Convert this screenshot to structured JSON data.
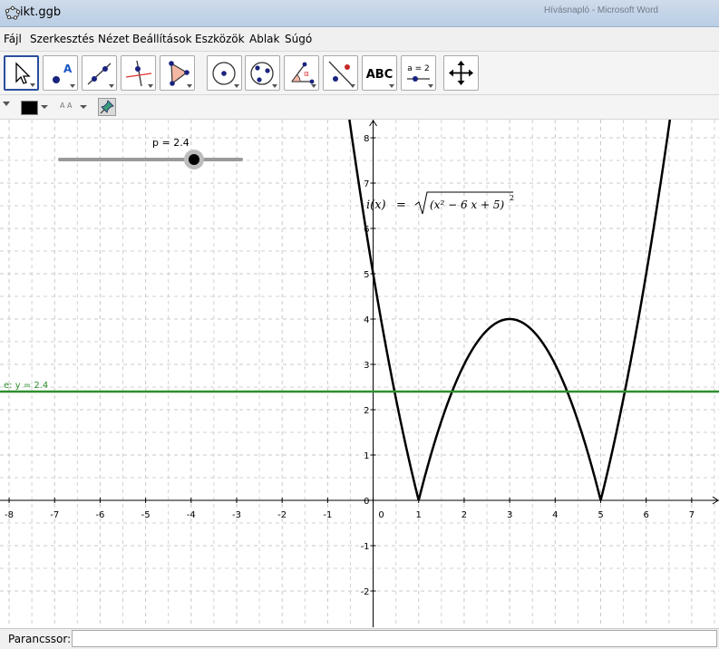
{
  "window": {
    "title": "ikt.ggb",
    "background_text": "Hívásnapló - Microsoft Word"
  },
  "menu": [
    "Fájl",
    "Szerkesztés",
    "Nézet",
    "Beállítások",
    "Eszközök",
    "Ablak",
    "Súgó"
  ],
  "toolbar": {
    "tools": [
      {
        "name": "move-tool-icon"
      },
      {
        "name": "new-point-tool-icon"
      },
      {
        "name": "line-tool-icon"
      },
      {
        "name": "perpendicular-line-tool-icon"
      },
      {
        "name": "polygon-tool-icon"
      },
      {
        "name": "circle-center-point-tool-icon"
      },
      {
        "name": "circle-three-points-tool-icon"
      },
      {
        "name": "angle-tool-icon"
      },
      {
        "name": "reflect-tool-icon"
      },
      {
        "name": "text-tool-icon",
        "label": "ABC"
      },
      {
        "name": "slider-tool-icon",
        "label": "a = 2"
      },
      {
        "name": "move-view-tool-icon"
      }
    ]
  },
  "stylebar": {
    "color": "#000000",
    "size_label": "A A"
  },
  "graphics": {
    "slider": {
      "label": "p = 2.4",
      "value": 2.4,
      "min": -5,
      "max": 5
    },
    "function_label": {
      "name": "i(x)",
      "equals": "=",
      "radicand": "(x² − 6 x + 5)",
      "exponent": "2"
    },
    "line_label": "e: y = 2.4",
    "x_ticks": [
      "-8",
      "-7",
      "-6",
      "-5",
      "-4",
      "-3",
      "-2",
      "-1",
      "0",
      "1",
      "2",
      "3",
      "4",
      "5",
      "6",
      "7"
    ],
    "y_ticks": [
      "-2",
      "-1",
      "0",
      "1",
      "2",
      "3",
      "4",
      "5",
      "6",
      "7",
      "8"
    ],
    "colors": {
      "function": "#000000",
      "line": "#2d8f2d",
      "grid": "#c8c8c8",
      "label_green": "#2d8f2d"
    }
  },
  "chart_data": {
    "type": "line",
    "title": "",
    "xlabel": "",
    "ylabel": "",
    "xlim": [
      -8.2,
      7.6
    ],
    "ylim": [
      -2.8,
      8.4
    ],
    "grid": true,
    "series": [
      {
        "name": "i(x)",
        "expression": "sqrt((x^2 - 6x + 5)^2)",
        "x": [
          -0.6,
          -0.4,
          -0.2,
          0,
          0.5,
          1,
          1.5,
          2,
          2.5,
          3,
          3.5,
          4,
          4.5,
          5,
          5.5,
          6,
          6.5
        ],
        "y": [
          8.96,
          7.56,
          6.24,
          5,
          2.25,
          0,
          1.75,
          3,
          3.75,
          4,
          3.75,
          3,
          1.75,
          0,
          2.25,
          5,
          8.25
        ]
      },
      {
        "name": "e",
        "expression": "y = 2.4",
        "x": [
          -8.2,
          7.6
        ],
        "y": [
          2.4,
          2.4
        ]
      }
    ]
  },
  "inputbar": {
    "label": "Parancssor:",
    "value": ""
  }
}
